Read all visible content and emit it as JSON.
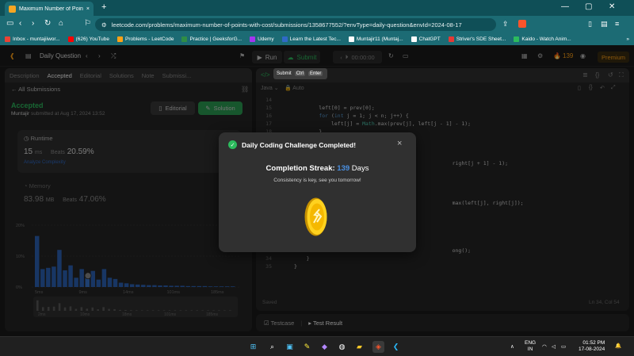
{
  "browser": {
    "tab_title": "Maximum Number of Points wi...",
    "tab_close": "×",
    "new_tab": "+",
    "url": "leetcode.com/problems/maximum-number-of-points-with-cost/submissions/1358677552/?envType=daily-question&envId=2024-08-17",
    "bookmarks": [
      {
        "label": "Inbox - muntajiiwor...",
        "color": "#ea4335"
      },
      {
        "label": "(626) YouTube",
        "color": "#ff0000"
      },
      {
        "label": "Problems - LeetCode",
        "color": "#ffa116"
      },
      {
        "label": "Practice | GeeksforG...",
        "color": "#2f8d46"
      },
      {
        "label": "Udemy",
        "color": "#a435f0"
      },
      {
        "label": "Learn the Latest Tec...",
        "color": "#2f6ac6"
      },
      {
        "label": "Muntajir11 (Muntaj...",
        "color": "#ffffff"
      },
      {
        "label": "ChatGPT",
        "color": "#ffffff"
      },
      {
        "label": "Striver's SDE Sheet...",
        "color": "#e53935"
      },
      {
        "label": "Kaido - Watch Anim...",
        "color": "#2cbb5d"
      }
    ],
    "more_bookmarks": "»"
  },
  "leetcode_nav": {
    "problem_list": "Daily Question",
    "run": "Run",
    "submit": "Submit",
    "timer": "00:00:00",
    "streak_count": "139",
    "premium": "Premium"
  },
  "left_panel": {
    "tabs": [
      {
        "label": "Description",
        "active": false
      },
      {
        "label": "Accepted",
        "active": true
      },
      {
        "label": "Editorial",
        "active": false
      },
      {
        "label": "Solutions",
        "active": false
      },
      {
        "label": "Note",
        "active": false
      },
      {
        "label": "Submissi...",
        "active": false
      }
    ],
    "all_submissions": "All Submissions",
    "status": "Accepted",
    "user": "Muntajir",
    "submitted_at": "submitted at Aug 17, 2024 13:52",
    "editorial_btn": "Editorial",
    "solution_btn": "Solution",
    "runtime": {
      "label": "Runtime",
      "value": "15",
      "unit": "ms",
      "beats_label": "Beats",
      "beats": "20.59%",
      "analyze": "Analyze Complexity"
    },
    "memory": {
      "label": "Memory",
      "value": "83.98",
      "unit": "MB",
      "beats_label": "Beats",
      "beats": "47.06%"
    }
  },
  "chart_data": {
    "type": "bar",
    "ylabels": [
      "20%",
      "10%",
      "0%"
    ],
    "xlabels": [
      "5ms",
      "9ms",
      "14ms",
      "101ms",
      "185ms"
    ],
    "values": [
      16.5,
      5.8,
      6.2,
      6.6,
      12,
      5.4,
      7,
      3,
      5.8,
      3.4,
      5.2,
      2.4,
      5.8,
      3,
      2.6,
      1.4,
      1.2,
      0.9,
      0.8,
      0.7,
      0.6,
      0.6,
      0.5,
      0.5,
      0.4,
      0.4,
      0.4,
      0.3,
      0.3,
      0.3,
      0.3,
      0.2,
      0.2,
      0.2,
      0.2,
      0.2
    ],
    "highlight_index": 9,
    "mini_xlabels": [
      "2ms",
      "10ms",
      "18ms",
      "101ms",
      "185ms"
    ],
    "ylim": [
      0,
      20
    ],
    "bar_color": "#2f6ac6"
  },
  "editor": {
    "language": "Java",
    "auto": "Auto",
    "lines": [
      {
        "n": "14",
        "text": ""
      },
      {
        "n": "15",
        "text": "        left[0] = prev[0];"
      },
      {
        "n": "16",
        "text": "        for (int j = 1; j < n; j++) {"
      },
      {
        "n": "17",
        "text": "            left[j] = Math.max(prev[j], left[j - 1] - 1);"
      },
      {
        "n": "18",
        "text": "        }"
      },
      {
        "n": "19",
        "text": ""
      },
      {
        "n": "20",
        "text": ""
      },
      {
        "n": "21",
        "text": ""
      },
      {
        "n": "22",
        "text": "                                                   right[j + 1] - 1);"
      },
      {
        "n": "23",
        "text": ""
      },
      {
        "n": "24",
        "text": ""
      },
      {
        "n": "25",
        "text": ""
      },
      {
        "n": "26",
        "text": ""
      },
      {
        "n": "27",
        "text": "                                                   max(left[j], right[j]);"
      },
      {
        "n": "28",
        "text": ""
      },
      {
        "n": "29",
        "text": ""
      },
      {
        "n": "30",
        "text": ""
      },
      {
        "n": "31",
        "text": ""
      },
      {
        "n": "32",
        "text": ""
      },
      {
        "n": "33",
        "text": "                                                   ong();"
      },
      {
        "n": "34",
        "text": "    }"
      },
      {
        "n": "35",
        "text": "}"
      }
    ],
    "saved": "Saved",
    "cursor": "Ln 34, Col 54"
  },
  "tooltip": {
    "label": "Submit",
    "key1": "Ctrl",
    "key2": "Enter"
  },
  "test_panel": {
    "testcase": "Testcase",
    "result": "Test Result"
  },
  "modal": {
    "title": "Daily Coding Challenge Completed!",
    "streak_label": "Completion Streak:",
    "streak_value": "139",
    "streak_unit": "Days",
    "message": "Consistency is key, see you tomorrow!",
    "close": "×"
  },
  "taskbar": {
    "lang1": "ENG",
    "lang2": "IN",
    "time": "01:52 PM",
    "date": "17-08-2024"
  }
}
